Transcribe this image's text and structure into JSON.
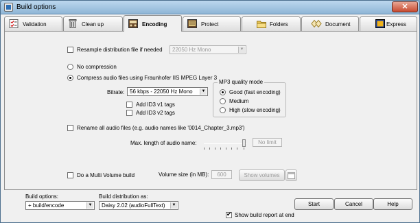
{
  "window": {
    "title": "Build options",
    "close_label": "✕"
  },
  "tabs": [
    {
      "label": "Validation",
      "icon": "checklist-icon",
      "active": false
    },
    {
      "label": "Clean up",
      "icon": "trash-icon",
      "active": false
    },
    {
      "label": "Encoding",
      "icon": "encoding-icon",
      "active": true
    },
    {
      "label": "Protect",
      "icon": "protect-icon",
      "active": false
    },
    {
      "label": "Folders",
      "icon": "folders-icon",
      "active": false
    },
    {
      "label": "Document",
      "icon": "document-icon",
      "active": false
    },
    {
      "label": "Express",
      "icon": "express-icon",
      "active": false
    }
  ],
  "encoding": {
    "resample_label": "Resample distribution file if needed",
    "resample_checked": false,
    "resample_value": "22050 Hz Mono",
    "no_compression_label": "No compression",
    "compress_label": "Compress audio files using Fraunhofer IIS MPEG Layer 3",
    "bitrate_label": "Bitrate:",
    "bitrate_value": "56 kbps - 22050 Hz Mono",
    "id3v1_label": "Add ID3 v1 tags",
    "id3v2_label": "Add ID3 v2 tags",
    "quality_legend": "MP3 quality mode",
    "quality_good": "Good (fast encoding)",
    "quality_medium": "Medium",
    "quality_high": "High (slow encoding)",
    "rename_label": "Rename all audio files (e.g. audio names like '0014_Chapter_3.mp3')",
    "max_length_label": "Max. length of audio name:",
    "max_length_value": "No limit",
    "multivolume_label": "Do a Multi Volume build",
    "volume_size_label": "Volume size (in MB):",
    "volume_size_value": "600",
    "show_volumes_label": "Show volumes"
  },
  "footer": {
    "build_options_label": "Build options:",
    "build_options_value": "+ build/encode",
    "build_dist_label": "Build distribution as:",
    "build_dist_value": "Daisy 2.02 (audioFullText)",
    "start_label": "Start",
    "cancel_label": "Cancel",
    "help_label": "Help",
    "show_report_label": "Show build report at end",
    "show_report_checked": true
  }
}
